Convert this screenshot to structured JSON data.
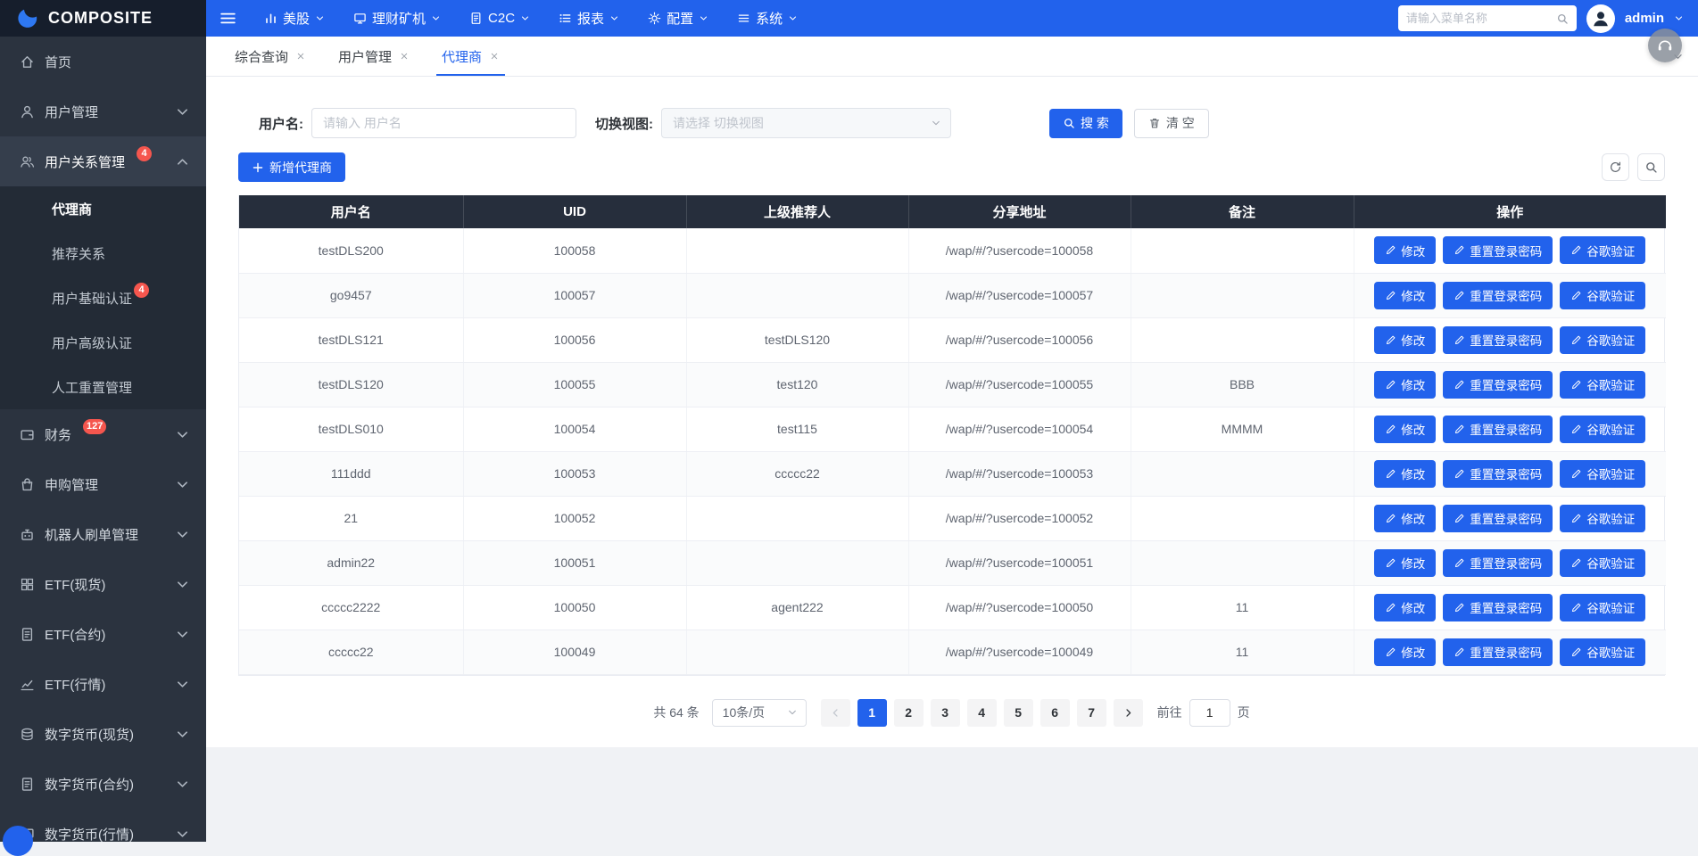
{
  "colors": {
    "accent": "#2262ec",
    "topbar-bg": "#2262ec",
    "logo-bg": "#161e2c",
    "sidebar-bg": "#2b333f",
    "sidebar-active-bg": "#353e4c",
    "submenu-bg": "#232b36",
    "table-header-bg": "#262e3c",
    "badge": "#f5564e"
  },
  "topbar": {
    "logo": "COMPOSITE",
    "nav": [
      {
        "label": "美股",
        "icon": "bar-chart-icon"
      },
      {
        "label": "理财矿机",
        "icon": "monitor-icon"
      },
      {
        "label": "C2C",
        "icon": "doc-icon"
      },
      {
        "label": "报表",
        "icon": "list-icon"
      },
      {
        "label": "配置",
        "icon": "gear-icon"
      },
      {
        "label": "系统",
        "icon": "menu-lines-icon"
      }
    ],
    "search_placeholder": "请输入菜单名称",
    "user": "admin"
  },
  "tabs": [
    {
      "label": "综合查询",
      "active": false
    },
    {
      "label": "用户管理",
      "active": false
    },
    {
      "label": "代理商",
      "active": true
    }
  ],
  "sidebar": {
    "items": [
      {
        "label": "首页",
        "icon": "home-icon"
      },
      {
        "label": "用户管理",
        "icon": "user-icon",
        "chevron": "down"
      },
      {
        "label": "用户关系管理",
        "icon": "users-icon",
        "badge": "4",
        "chevron": "up",
        "expanded": true,
        "children": [
          {
            "label": "代理商",
            "active": true
          },
          {
            "label": "推荐关系"
          },
          {
            "label": "用户基础认证",
            "badge": "4"
          },
          {
            "label": "用户高级认证"
          },
          {
            "label": "人工重置管理"
          }
        ]
      },
      {
        "label": "财务",
        "icon": "wallet-icon",
        "badge": "127",
        "chevron": "down"
      },
      {
        "label": "申购管理",
        "icon": "bag-icon",
        "chevron": "down"
      },
      {
        "label": "机器人刷单管理",
        "icon": "robot-icon",
        "chevron": "down"
      },
      {
        "label": "ETF(现货)",
        "icon": "grid-icon",
        "chevron": "down"
      },
      {
        "label": "ETF(合约)",
        "icon": "doc-icon",
        "chevron": "down"
      },
      {
        "label": "ETF(行情)",
        "icon": "chart-line-icon",
        "chevron": "down"
      },
      {
        "label": "数字货币(现货)",
        "icon": "coins-icon",
        "chevron": "down"
      },
      {
        "label": "数字货币(合约)",
        "icon": "doc-icon",
        "chevron": "down"
      },
      {
        "label": "数字货币(行情)",
        "icon": "monitor-icon",
        "chevron": "down"
      }
    ]
  },
  "filters": {
    "username_label": "用户名:",
    "username_placeholder": "请输入 用户名",
    "view_label": "切换视图:",
    "view_placeholder": "请选择 切换视图",
    "search_button": "搜 索",
    "clear_button": "清 空"
  },
  "toolbar": {
    "add_button": "新增代理商"
  },
  "table": {
    "headers": [
      "用户名",
      "UID",
      "上级推荐人",
      "分享地址",
      "备注",
      "操作"
    ],
    "actions": [
      "修改",
      "重置登录密码",
      "谷歌验证"
    ],
    "rows": [
      {
        "username": "testDLS200",
        "uid": "100058",
        "referrer": "",
        "share_url": "/wap/#/?usercode=100058",
        "remark": ""
      },
      {
        "username": "go9457",
        "uid": "100057",
        "referrer": "",
        "share_url": "/wap/#/?usercode=100057",
        "remark": ""
      },
      {
        "username": "testDLS121",
        "uid": "100056",
        "referrer": "testDLS120",
        "share_url": "/wap/#/?usercode=100056",
        "remark": ""
      },
      {
        "username": "testDLS120",
        "uid": "100055",
        "referrer": "test120",
        "share_url": "/wap/#/?usercode=100055",
        "remark": "BBB"
      },
      {
        "username": "testDLS010",
        "uid": "100054",
        "referrer": "test115",
        "share_url": "/wap/#/?usercode=100054",
        "remark": "MMMM"
      },
      {
        "username": "111ddd",
        "uid": "100053",
        "referrer": "ccccc22",
        "share_url": "/wap/#/?usercode=100053",
        "remark": ""
      },
      {
        "username": "21",
        "uid": "100052",
        "referrer": "",
        "share_url": "/wap/#/?usercode=100052",
        "remark": ""
      },
      {
        "username": "admin22",
        "uid": "100051",
        "referrer": "",
        "share_url": "/wap/#/?usercode=100051",
        "remark": ""
      },
      {
        "username": "ccccc2222",
        "uid": "100050",
        "referrer": "agent222",
        "share_url": "/wap/#/?usercode=100050",
        "remark": "11"
      },
      {
        "username": "ccccc22",
        "uid": "100049",
        "referrer": "",
        "share_url": "/wap/#/?usercode=100049",
        "remark": "11"
      }
    ]
  },
  "pagination": {
    "total": "共 64 条",
    "page_size": "10条/页",
    "pages": [
      "1",
      "2",
      "3",
      "4",
      "5",
      "6",
      "7"
    ],
    "current": "1",
    "goto_label": "前往",
    "goto_value": "1",
    "goto_suffix": "页"
  }
}
